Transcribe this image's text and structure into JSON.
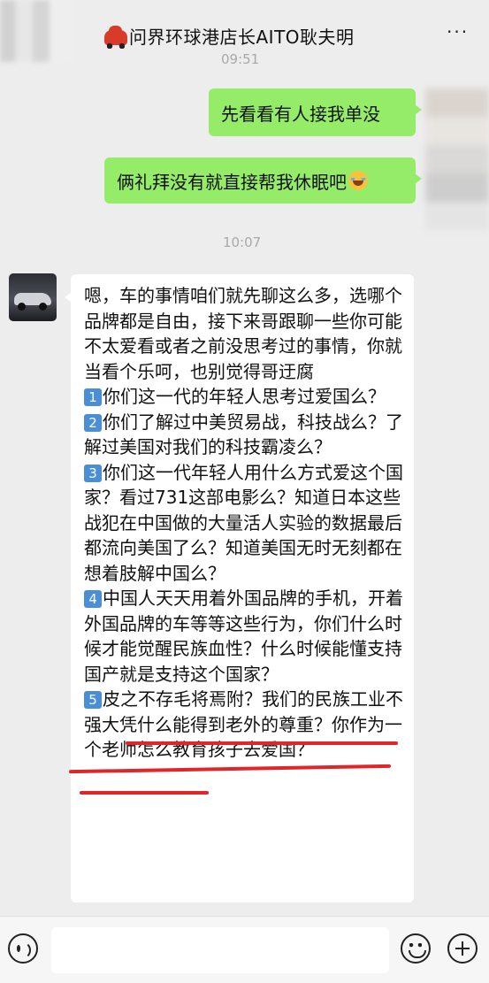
{
  "header": {
    "title": "问界环球港店长AITO耿夫明",
    "title_emoji": "car-emoji",
    "more_label": "···"
  },
  "timestamps": [
    "09:51",
    "10:07"
  ],
  "outgoing_messages": [
    {
      "text": "先看看有人接我单没"
    },
    {
      "text": "俩礼拜没有就直接帮我休眠吧",
      "emoji": "laughing-tears-emoji"
    }
  ],
  "incoming_message": {
    "intro": "嗯，车的事情咱们就先聊这么多，选哪个品牌都是自由，接下来哥跟聊一些你可能不太爱看或者之前没思考过的事情，你就当看个乐呵，也别觉得哥迂腐",
    "points": [
      {
        "num": "1",
        "text": "你们这一代的年轻人思考过爱国么？"
      },
      {
        "num": "2",
        "text": "你们了解过中美贸易战，科技战么？了解过美国对我们的科技霸凌么？"
      },
      {
        "num": "3",
        "text": "你们这一代年轻人用什么方式爱这个国家？看过731这部电影么？知道日本这些战犯在中国做的大量活人实验的数据最后都流向美国了么？知道美国无时无刻都在想着肢解中国么？"
      },
      {
        "num": "4",
        "text": "中国人天天用着外国品牌的手机，开着外国品牌的车等等这些行为，你们什么时候才能觉醒民族血性？什么时候能懂支持国产就是支持这个国家？"
      },
      {
        "num": "5",
        "text": "皮之不存毛将焉附？我们的民族工业不强大凭什么能得到老外的尊重？你作为一个老师怎么教育孩子去爱国？"
      }
    ]
  },
  "annotation": {
    "underline_color": "#e0262b"
  },
  "colors": {
    "outgoing_bubble": "#95ec69",
    "incoming_bubble": "#ffffff",
    "background": "#ededed",
    "number_badge": "#4a8fd6"
  },
  "input_bar": {
    "left_icon": "voice-icon",
    "right_icons": [
      "emoji-icon",
      "plus-icon"
    ]
  }
}
